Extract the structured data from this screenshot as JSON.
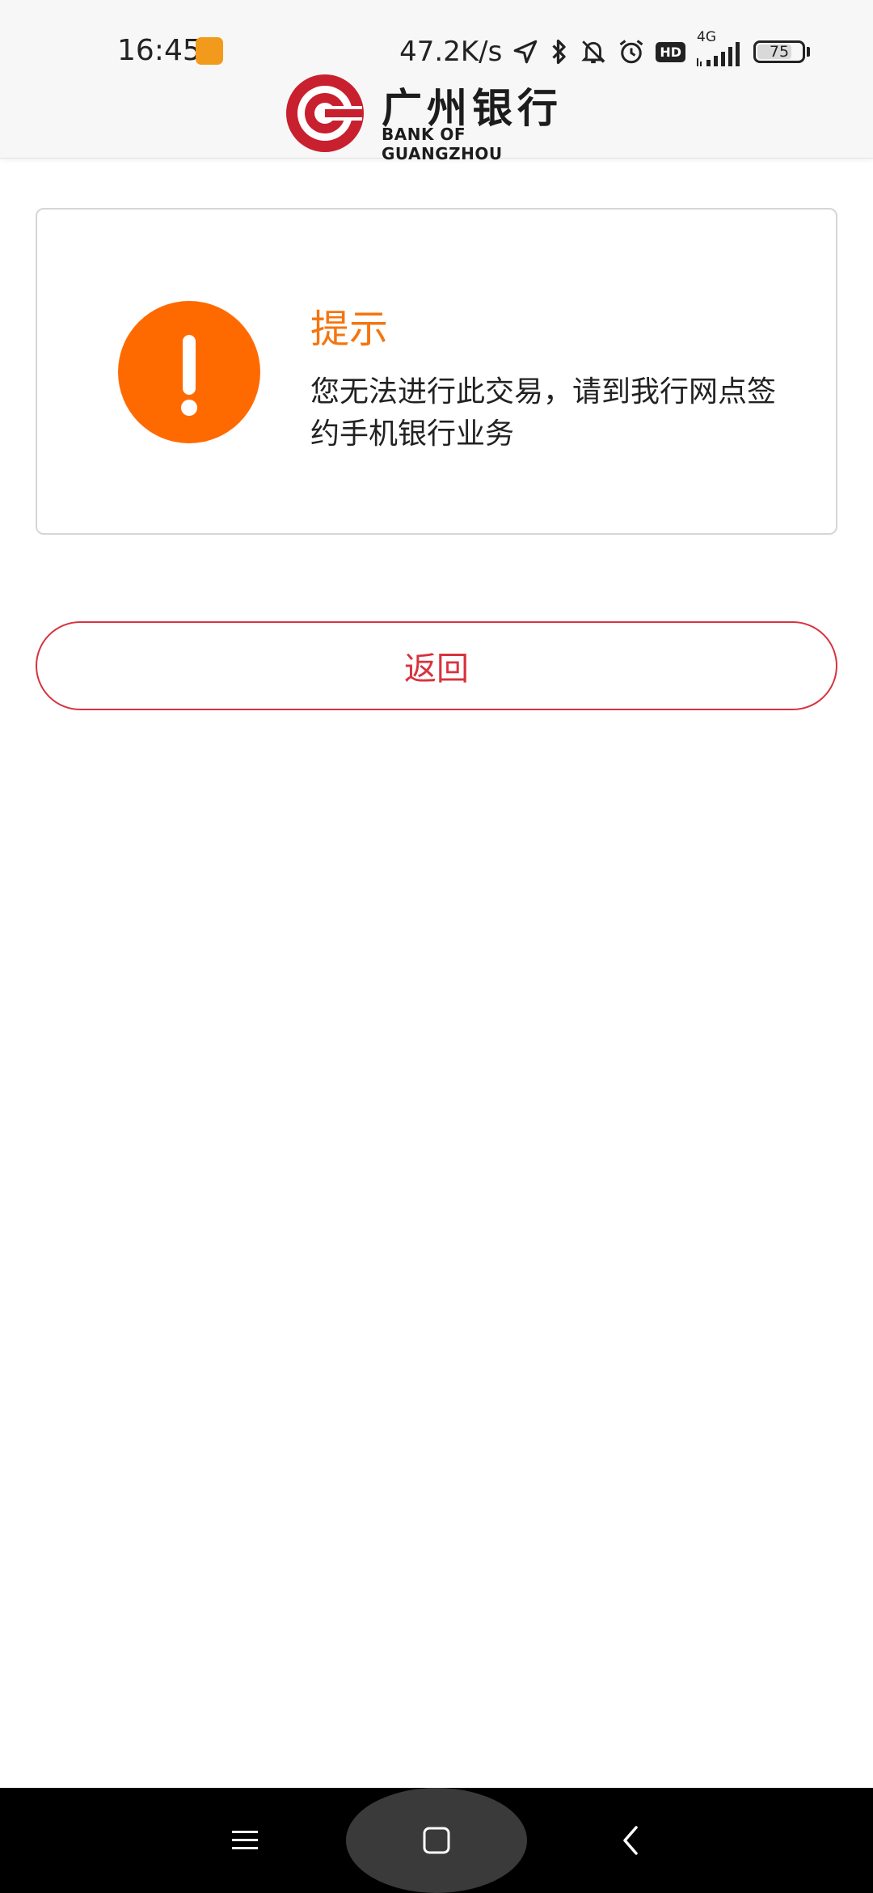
{
  "status_bar": {
    "time": "16:45",
    "net_speed": "47.2K/s",
    "hd_label": "HD",
    "network_type": "4G",
    "battery_level": "75"
  },
  "logo": {
    "cn_name": "广州银行",
    "en_name": "BANK OF GUANGZHOU"
  },
  "notice": {
    "title": "提示",
    "message": " 您无法进行此交易，请到我行网点签约手机银行业务"
  },
  "return_button": {
    "label": "返回"
  },
  "colors": {
    "brand_red": "#d8333e",
    "warning_orange": "#ff6a00",
    "title_orange": "#f5750f"
  },
  "icons": {
    "warning": "exclamation-circle-icon",
    "nav_menu": "menu-icon",
    "nav_home": "home-square-icon",
    "nav_back": "chevron-left-icon"
  }
}
